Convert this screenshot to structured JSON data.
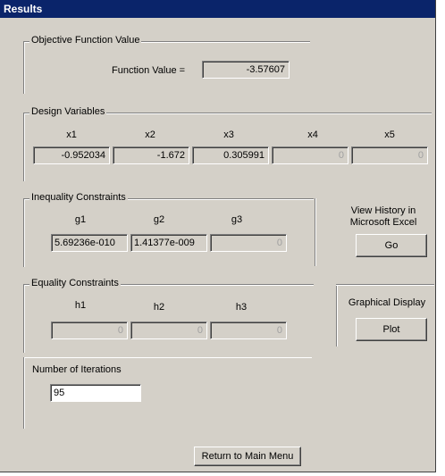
{
  "window": {
    "title": "Results"
  },
  "objective": {
    "group_label": "Objective Function Value",
    "function_value_label": "Function Value =",
    "function_value": "-3.57607"
  },
  "design_variables": {
    "group_label": "Design Variables",
    "items": [
      {
        "label": "x1",
        "value": "-0.952034"
      },
      {
        "label": "x2",
        "value": "-1.672"
      },
      {
        "label": "x3",
        "value": "0.305991"
      },
      {
        "label": "x4",
        "value": "0"
      },
      {
        "label": "x5",
        "value": "0"
      }
    ]
  },
  "inequality": {
    "group_label": "Inequality Constraints",
    "items": [
      {
        "label": "g1",
        "value": "5.69236e-010"
      },
      {
        "label": "g2",
        "value": "1.41377e-009"
      },
      {
        "label": "g3",
        "value": "0"
      }
    ]
  },
  "equality": {
    "group_label": "Equality Constraints",
    "items": [
      {
        "label": "h1",
        "value": "0"
      },
      {
        "label": "h2",
        "value": "0"
      },
      {
        "label": "h3",
        "value": "0"
      }
    ]
  },
  "iterations": {
    "label": "Number of Iterations",
    "value": "95"
  },
  "history": {
    "label_line1": "View History in",
    "label_line2": "Microsoft Excel",
    "button": "Go"
  },
  "graphical": {
    "label": "Graphical Display",
    "button": "Plot"
  },
  "footer": {
    "return_button": "Return to Main Menu"
  }
}
